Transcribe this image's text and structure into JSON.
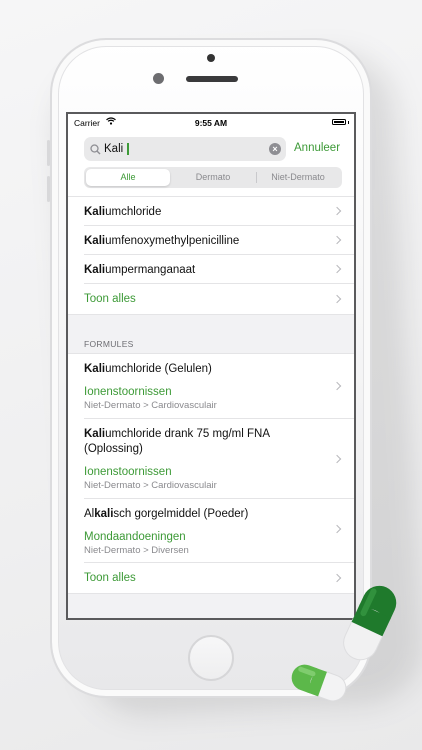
{
  "status": {
    "carrier": "Carrier",
    "time": "9:55 AM"
  },
  "search": {
    "query": "Kali",
    "cancel_label": "Annuleer"
  },
  "segments": [
    "Alle",
    "Dermato",
    "Niet-Dermato"
  ],
  "segments_active": 0,
  "substances": [
    {
      "match": "Kali",
      "rest": "umchloride"
    },
    {
      "match": "Kali",
      "rest": "umfenoxymethylpenicilline"
    },
    {
      "match": "Kali",
      "rest": "umpermanganaat"
    }
  ],
  "substances_show_all": "Toon alles",
  "formulas_header": "FORMULES",
  "formulas": [
    {
      "pre": "",
      "match": "Kali",
      "rest": "umchloride (Gelulen)",
      "category": "Ionenstoornissen",
      "path": "Niet-Dermato > Cardiovasculair"
    },
    {
      "pre": "",
      "match": "Kali",
      "rest": "umchloride drank 75 mg/ml FNA",
      "rest2": "(Oplossing)",
      "category": "Ionenstoornissen",
      "path": "Niet-Dermato > Cardiovasculair"
    },
    {
      "pre": "Al",
      "match": "kali",
      "rest": "sch gorgelmiddel (Poeder)",
      "category": "Mondaandoeningen",
      "path": "Niet-Dermato > Diversen"
    }
  ],
  "formulas_show_all": "Toon alles",
  "colors": {
    "accent": "#3d9a37",
    "pill_dark": "#1f7a2c",
    "pill_light": "#5cb84a"
  }
}
